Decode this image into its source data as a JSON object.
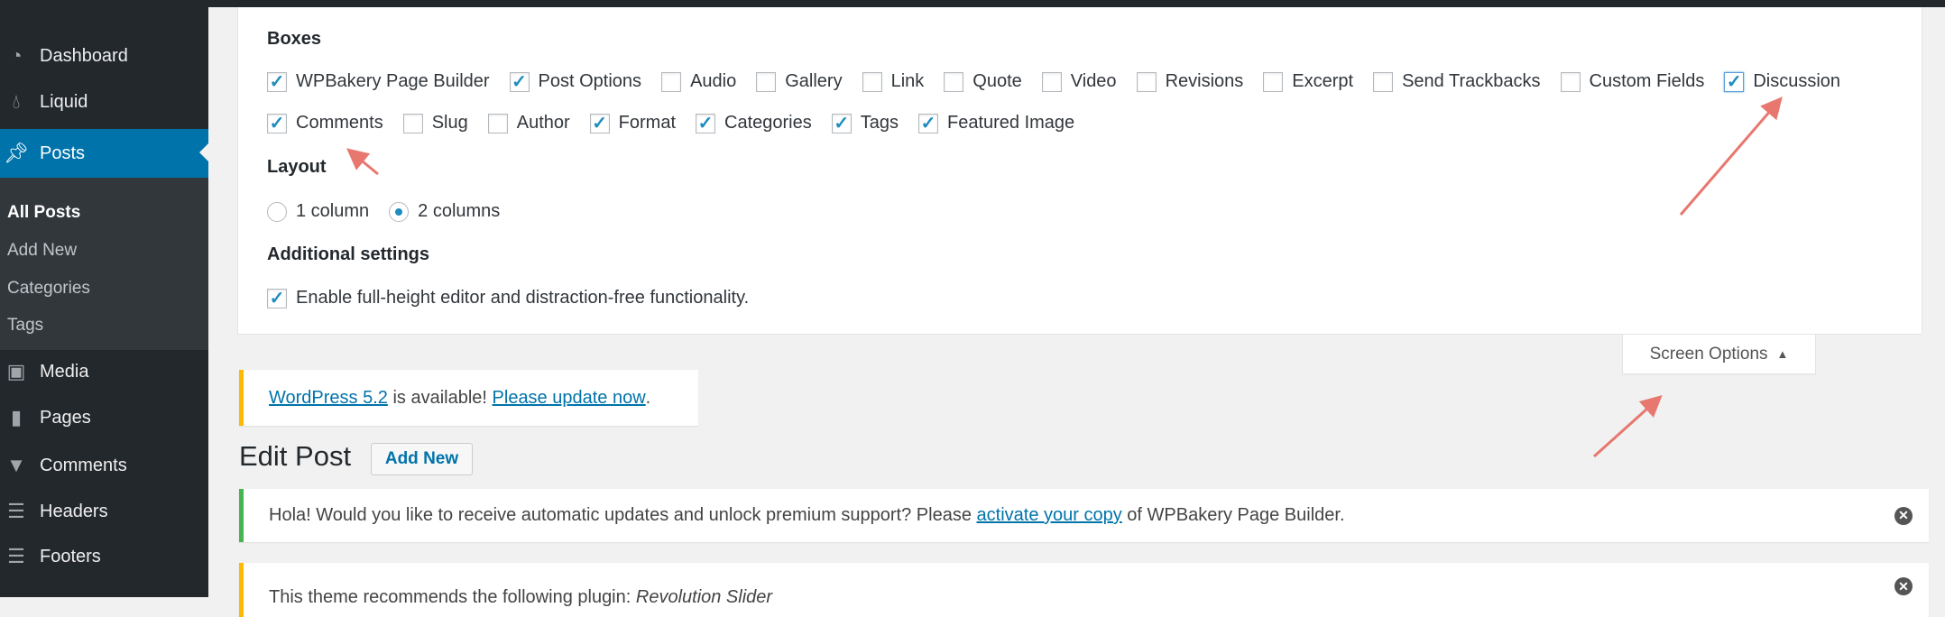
{
  "sidebar": {
    "items": [
      {
        "label": "Dashboard",
        "icon": "dashboard-icon"
      },
      {
        "label": "Liquid",
        "icon": "drop-icon"
      },
      {
        "label": "Posts",
        "icon": "pin-icon"
      },
      {
        "label": "Media",
        "icon": "media-icon"
      },
      {
        "label": "Pages",
        "icon": "pages-icon"
      },
      {
        "label": "Comments",
        "icon": "comment-icon"
      },
      {
        "label": "Headers",
        "icon": "header-icon"
      },
      {
        "label": "Footers",
        "icon": "footer-icon"
      }
    ],
    "submenu": [
      "All Posts",
      "Add New",
      "Categories",
      "Tags"
    ]
  },
  "screen_options": {
    "boxes_heading": "Boxes",
    "boxes": [
      {
        "label": "WPBakery Page Builder",
        "checked": true
      },
      {
        "label": "Post Options",
        "checked": true
      },
      {
        "label": "Audio",
        "checked": false
      },
      {
        "label": "Gallery",
        "checked": false
      },
      {
        "label": "Link",
        "checked": false
      },
      {
        "label": "Quote",
        "checked": false
      },
      {
        "label": "Video",
        "checked": false
      },
      {
        "label": "Revisions",
        "checked": false
      },
      {
        "label": "Excerpt",
        "checked": false
      },
      {
        "label": "Send Trackbacks",
        "checked": false
      },
      {
        "label": "Custom Fields",
        "checked": false
      },
      {
        "label": "Discussion",
        "checked": true
      },
      {
        "label": "Comments",
        "checked": true
      },
      {
        "label": "Slug",
        "checked": false
      },
      {
        "label": "Author",
        "checked": false
      },
      {
        "label": "Format",
        "checked": true
      },
      {
        "label": "Categories",
        "checked": true
      },
      {
        "label": "Tags",
        "checked": true
      },
      {
        "label": "Featured Image",
        "checked": true
      }
    ],
    "layout_heading": "Layout",
    "layout_options": [
      "1 column",
      "2 columns"
    ],
    "layout_selected": "2 columns",
    "additional_heading": "Additional settings",
    "additional_option": "Enable full-height editor and distraction-free functionality.",
    "tab_label": "Screen Options"
  },
  "update_notice": {
    "link1": "WordPress 5.2",
    "text": " is available! ",
    "link2": "Please update now",
    "end": "."
  },
  "page_title": "Edit Post",
  "add_new": "Add New",
  "wpbakery_notice": {
    "text1": "Hola! Would you like to receive automatic updates and unlock premium support? Please ",
    "link": "activate your copy",
    "text2": " of WPBakery Page Builder."
  },
  "theme_notice": {
    "text": "This theme recommends the following plugin: ",
    "plugin": "Revolution Slider"
  },
  "colors": {
    "accent": "#0073aa",
    "annotation": "#e8776f"
  }
}
